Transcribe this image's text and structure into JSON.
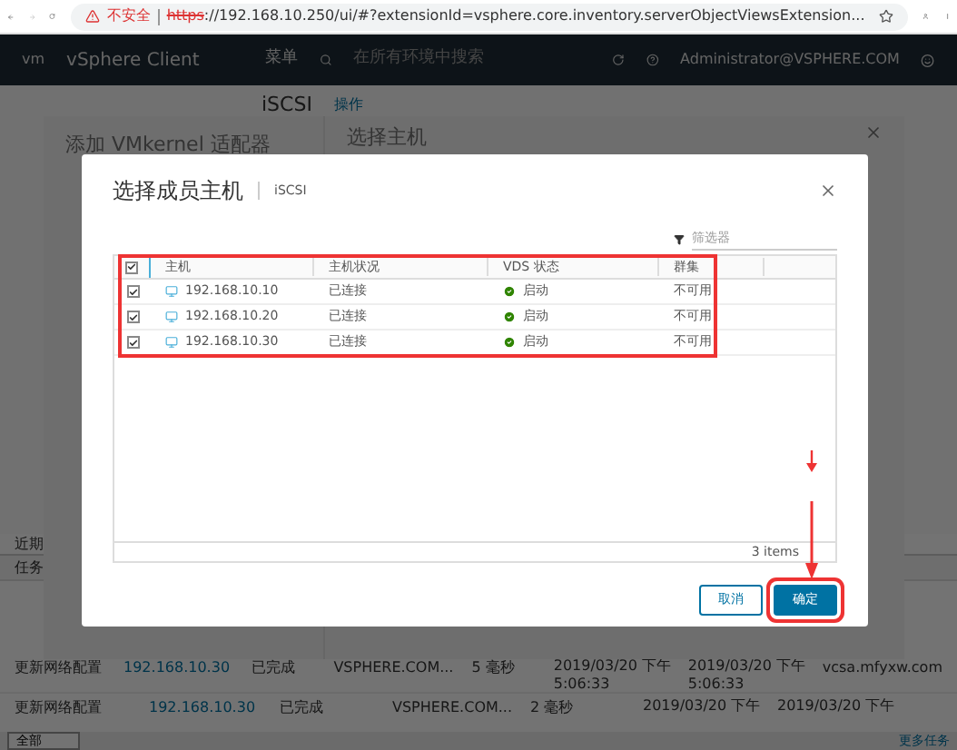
{
  "browser": {
    "warning": "不安全",
    "scheme": "https",
    "url": "://192.168.10.250/ui/#?extensionId=vsphere.core.inventory.serverObjectViewsExtension..."
  },
  "header": {
    "logo": "vm",
    "app": "vSphere Client",
    "menu": "菜单",
    "search_placeholder": "在所有环境中搜索",
    "user": "Administrator@VSPHERE.COM"
  },
  "toolbar": {
    "object": "iSCSI",
    "actions": "操作"
  },
  "tasks": {
    "tab": "近期",
    "column": "任务",
    "rows": [
      {
        "name": "更新网络配置",
        "target": "192.168.10.30",
        "status": "已完成",
        "initiator": "VSPHERE.COM...",
        "queued": "5 毫秒",
        "start": [
          "2019/03/20 下午",
          "5:06:33"
        ],
        "end": [
          "2019/03/20 下午",
          "5:06:33"
        ],
        "server": "vcsa.mfyxw.com"
      },
      {
        "name": "更新网络配置",
        "target": "192.168.10.30",
        "status": "已完成",
        "initiator": "VSPHERE.COM...",
        "queued": "2 毫秒",
        "start": [
          "2019/03/20 下午"
        ],
        "end": [
          "2019/03/20 下午"
        ],
        "server": ""
      }
    ],
    "filter": "全部",
    "more": "更多任务"
  },
  "wizard": {
    "title": "添加 VMkernel 适配器",
    "step": "选择主机"
  },
  "dialog": {
    "title": "选择成员主机",
    "subtitle": "iSCSI",
    "filter_placeholder": "筛选器",
    "select_all": true,
    "columns": [
      "主机",
      "主机状况",
      "VDS 状态",
      "群集"
    ],
    "rows": [
      {
        "checked": true,
        "host": "192.168.10.10",
        "state": "已连接",
        "vds": "启动",
        "cluster": "不可用"
      },
      {
        "checked": true,
        "host": "192.168.10.20",
        "state": "已连接",
        "vds": "启动",
        "cluster": "不可用"
      },
      {
        "checked": true,
        "host": "192.168.10.30",
        "state": "已连接",
        "vds": "启动",
        "cluster": "不可用"
      }
    ],
    "footer": "3 items",
    "buttons": [
      {
        "label": "取消",
        "kind": "secondary"
      },
      {
        "label": "确定",
        "kind": "primary"
      }
    ]
  }
}
